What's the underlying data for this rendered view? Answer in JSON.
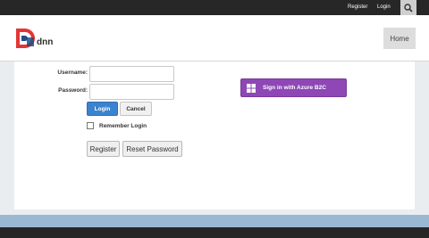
{
  "topbar": {
    "register_label": "Register",
    "login_label": "Login",
    "search_icon": "search-icon"
  },
  "header": {
    "logo_text": "DNN",
    "home_label": "Home"
  },
  "form": {
    "username_label": "Username:",
    "password_label": "Password:",
    "username_value": "",
    "password_value": "",
    "login_button": "Login",
    "cancel_button": "Cancel",
    "remember_label": "Remember Login",
    "remember_checked": false,
    "register_button": "Register",
    "reset_password_button": "Reset Password"
  },
  "external_login": {
    "azure_label": "Sign in with Azure B2C",
    "azure_icon": "windows-icon",
    "color": "#8e47b5"
  },
  "colors": {
    "primary_button": "#3a83cf",
    "topbar": "#272727",
    "footer_accent": "#9bb8d3"
  }
}
